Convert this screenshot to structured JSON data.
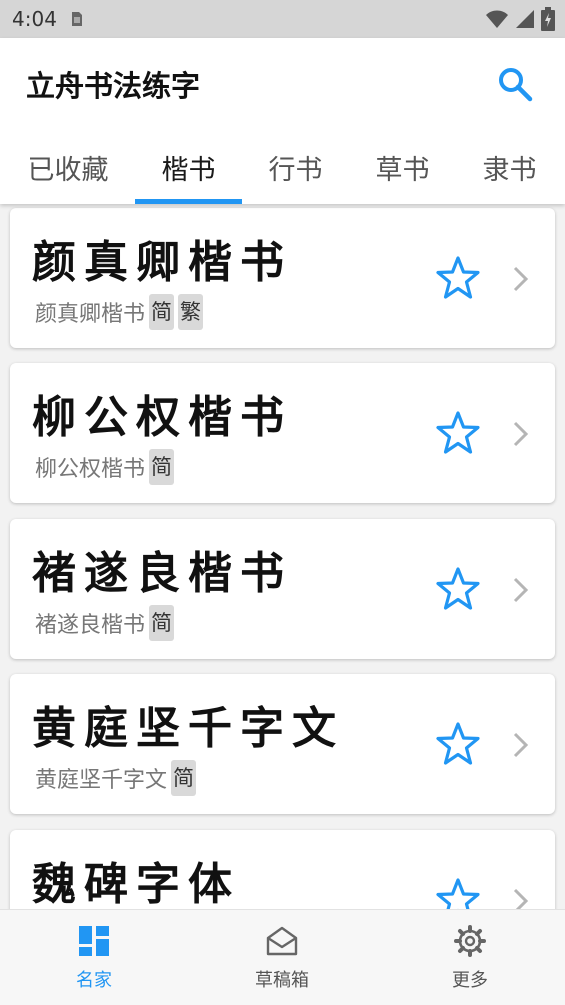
{
  "status_bar": {
    "time": "4:04"
  },
  "app": {
    "title": "立舟书法练字",
    "accent": "#2196f3"
  },
  "tabs": [
    {
      "label": "已收藏",
      "active": false
    },
    {
      "label": "楷书",
      "active": true
    },
    {
      "label": "行书",
      "active": false
    },
    {
      "label": "草书",
      "active": false
    },
    {
      "label": "隶书",
      "active": false
    }
  ],
  "items": [
    {
      "calligraphy": "颜真卿楷书",
      "name": "颜真卿楷书",
      "tags": [
        "简",
        "繁"
      ]
    },
    {
      "calligraphy": "柳公权楷书",
      "name": "柳公权楷书",
      "tags": [
        "简"
      ]
    },
    {
      "calligraphy": "褚遂良楷书",
      "name": "褚遂良楷书",
      "tags": [
        "简"
      ]
    },
    {
      "calligraphy": "黄庭坚千字文",
      "name": "黄庭坚千字文",
      "tags": [
        "简"
      ]
    },
    {
      "calligraphy": "魏碑字体",
      "name": "",
      "tags": []
    }
  ],
  "bottom_nav": [
    {
      "label": "名家",
      "icon": "grid-icon",
      "active": true
    },
    {
      "label": "草稿箱",
      "icon": "envelope-icon",
      "active": false
    },
    {
      "label": "更多",
      "icon": "gear-icon",
      "active": false
    }
  ]
}
